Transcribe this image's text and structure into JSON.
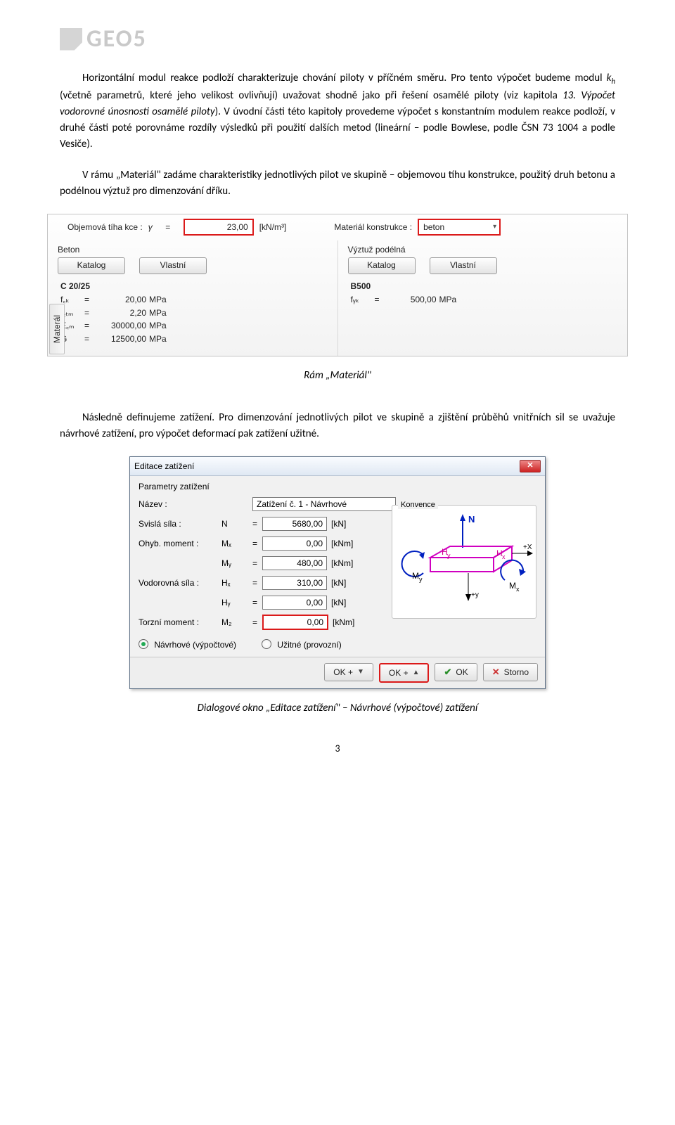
{
  "logo": "GEO5",
  "para1": "Horizontální modul reakce podloží charakterizuje chování piloty v příčném směru. Pro tento výpočet budeme modul kₕ (včetně parametrů, které jeho velikost ovlivňují) uvažovat shodně jako při řešení osamělé piloty (viz kapitola 13. Výpočet vodorovné únosnosti osamělé piloty). V úvodní části této kapitoly provedeme výpočet s konstantním modulem reakce podloží, v druhé části poté porovnáme rozdíly výsledků při použití dalších metod (lineární – podle Bowlese, podle ČSN 73 1004 a podle Vesiče).",
  "para2": "V rámu „Materiál\" zadáme charakteristiky jednotlivých pilot ve skupině – objemovou tíhu konstrukce, použitý druh betonu a podélnou výztuž pro dimenzování dříku.",
  "caption1": "Rám „Materiál\"",
  "para3": "Následně definujeme zatížení. Pro dimenzování jednotlivých pilot ve skupině a zjištění průběhů vnitřních sil se uvažuje návrhové zatížení, pro výpočet deformací pak zatížení užitné.",
  "caption2": "Dialogové okno „Editace zatížení\" – Návrhové (výpočtové) zatížení",
  "pageNum": "3",
  "frame1": {
    "weightLabel": "Objemová tíha kce :",
    "gamma": "γ",
    "eq": "=",
    "weightVal": "23,00",
    "weightUnit": "[kN/m³]",
    "matLabel": "Materiál konstrukce :",
    "matVal": "beton",
    "left": {
      "groupTitle": "Beton",
      "btn1": "Katalog",
      "btn2": "Vlastní",
      "matName": "C 20/25",
      "rows": [
        {
          "sym": "f꜀ₖ",
          "val": "20,00",
          "u": "MPa"
        },
        {
          "sym": "f꜀ₜₘ",
          "val": "2,20",
          "u": "MPa"
        },
        {
          "sym": "E꜀ₘ",
          "val": "30000,00",
          "u": "MPa"
        },
        {
          "sym": "G",
          "val": "12500,00",
          "u": "MPa"
        }
      ]
    },
    "right": {
      "groupTitle": "Výztuž podélná",
      "btn1": "Katalog",
      "btn2": "Vlastní",
      "matName": "B500",
      "rows": [
        {
          "sym": "fᵧₖ",
          "val": "500,00",
          "u": "MPa"
        }
      ]
    },
    "tab": "Materál"
  },
  "dlg": {
    "title": "Editace zatížení",
    "paramHead": "Parametry zatížení",
    "nameLabel": "Název :",
    "nameVal": "Zatížení č. 1 - Návrhové",
    "konv": "Konvence",
    "rows": [
      {
        "label": "Svislá síla :",
        "sym": "N",
        "val": "5680,00",
        "u": "[kN]"
      },
      {
        "label": "Ohyb. moment :",
        "sym": "Mₓ",
        "val": "0,00",
        "u": "[kNm]"
      },
      {
        "label": "",
        "sym": "Mᵧ",
        "val": "480,00",
        "u": "[kNm]"
      },
      {
        "label": "Vodorovná síla :",
        "sym": "Hₓ",
        "val": "310,00",
        "u": "[kN]"
      },
      {
        "label": "",
        "sym": "Hᵧ",
        "val": "0,00",
        "u": "[kN]"
      },
      {
        "label": "Torzní moment :",
        "sym": "M₂",
        "val": "0,00",
        "u": "[kNm]",
        "hl": true
      }
    ],
    "radio1": "Návrhové (výpočtové)",
    "radio2": "Užitné (provozní)",
    "btns": {
      "okDn": "OK + ",
      "okUp": "OK + ",
      "ok": "OK",
      "storno": "Storno"
    }
  }
}
